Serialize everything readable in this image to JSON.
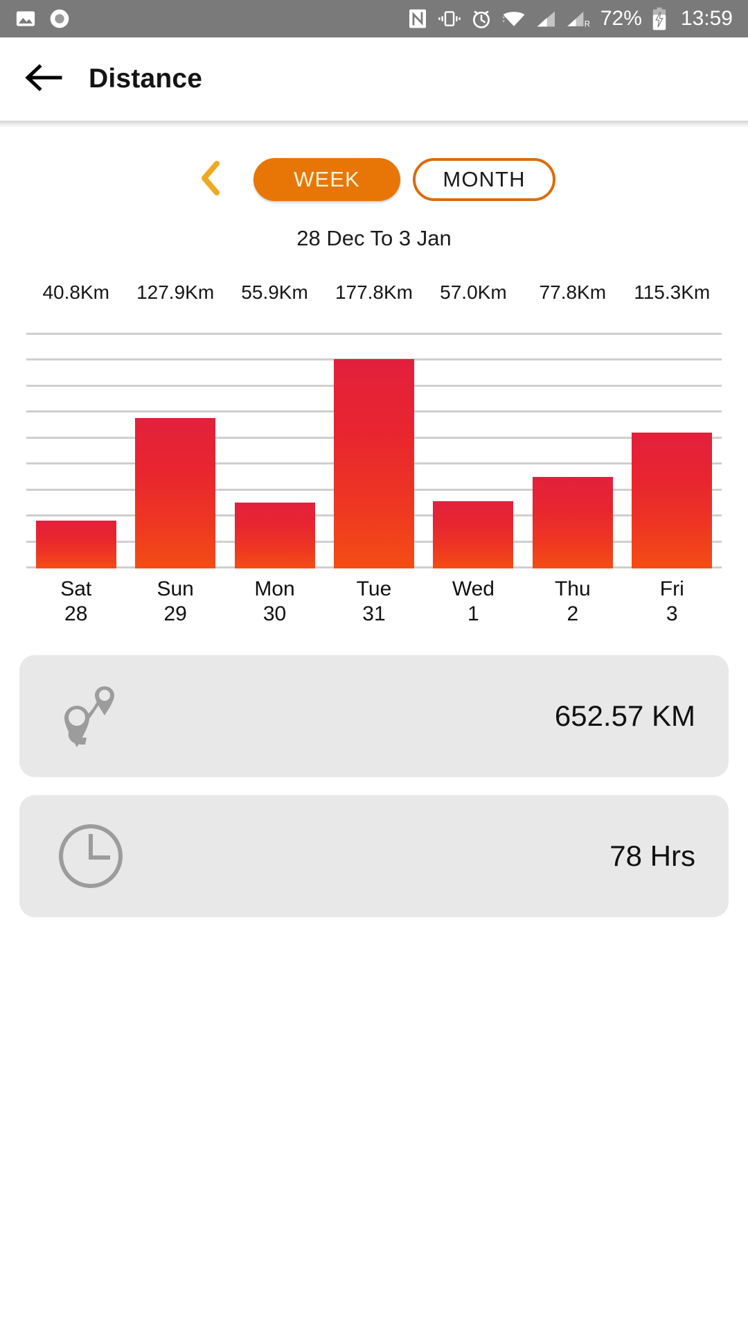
{
  "status_bar": {
    "icons_left": [
      "photo-icon",
      "record-circle-icon"
    ],
    "icons_right": [
      "nfc-icon",
      "vibrate-icon",
      "alarm-icon",
      "wifi-icon",
      "signal-sim1-icon",
      "signal-sim2-roaming-icon"
    ],
    "battery_percent": "72%",
    "battery_state": "charging",
    "time": "13:59"
  },
  "app_bar": {
    "back_icon": "arrow-left-icon",
    "title": "Distance"
  },
  "period_toggle": {
    "prev_icon": "chevron-left-icon",
    "week_label": "WEEK",
    "month_label": "MONTH",
    "selected": "WEEK",
    "active_color": "#E87606",
    "active_text_color": "#FDF3D8",
    "outline_color": "#DD6B0A"
  },
  "date_range": "28 Dec To 3 Jan",
  "chart_data": {
    "type": "bar",
    "title": "Distance",
    "subtitle": "28 Dec To 3 Jan",
    "xlabel": "",
    "ylabel": "",
    "unit": "Km",
    "grid": true,
    "gridlines": 10,
    "legend": "none",
    "ylim": [
      0,
      200
    ],
    "categories": [
      "Sat",
      "Sun",
      "Mon",
      "Tue",
      "Wed",
      "Thu",
      "Fri"
    ],
    "category_days": [
      "28",
      "29",
      "30",
      "31",
      "1",
      "2",
      "3"
    ],
    "values": [
      40.8,
      127.9,
      55.9,
      177.8,
      57.0,
      77.8,
      115.3
    ],
    "value_labels": [
      "40.8Km",
      "127.9Km",
      "55.9Km",
      "177.8Km",
      "57.0Km",
      "77.8Km",
      "115.3Km"
    ],
    "bar_gradient_top": "#E3203C",
    "bar_gradient_bottom": "#F44D14",
    "gridline_color": "#cfcfcf"
  },
  "summary_cards": [
    {
      "icon": "route-pin-icon",
      "value": "652.57 KM"
    },
    {
      "icon": "clock-icon",
      "value": "78 Hrs"
    }
  ]
}
